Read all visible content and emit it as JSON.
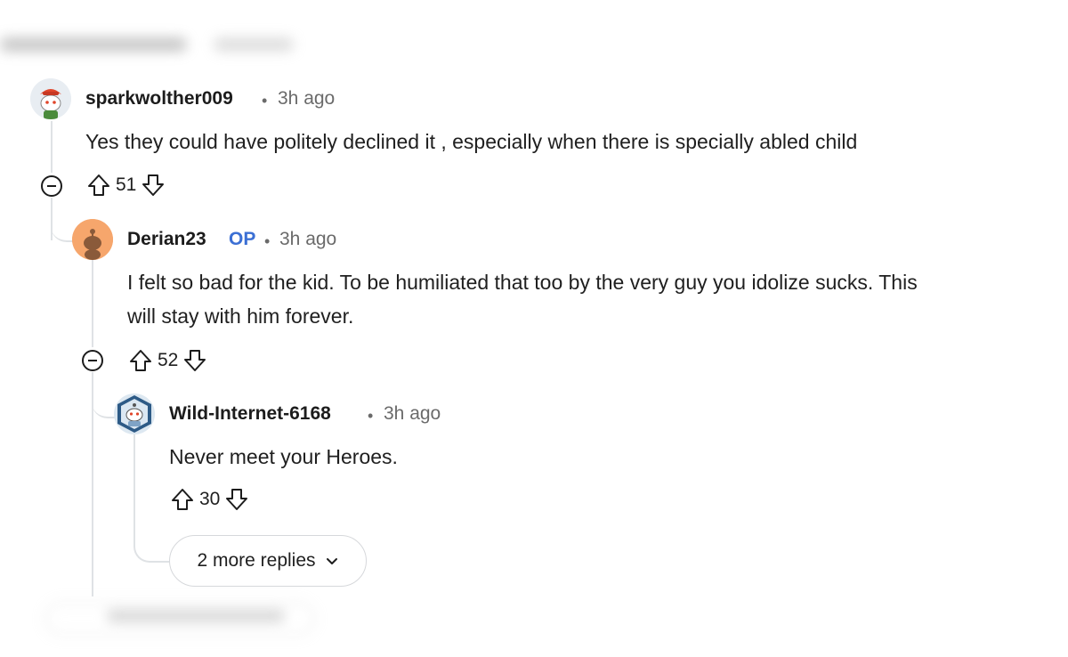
{
  "comments": [
    {
      "username": "sparkwolther009",
      "separator": "•",
      "time": "3h ago",
      "body_lines": [
        "Yes they could have politely declined it , especially when there is specially abled child"
      ],
      "votes": "51",
      "avatar": "snoo-avatar-red-hat",
      "icons": {
        "upvote": "upvote-arrow-icon",
        "downvote": "downvote-arrow-icon",
        "collapse": "collapse-minus-icon"
      }
    },
    {
      "username": "Derian23",
      "op_badge": "OP",
      "separator": "•",
      "time": "3h ago",
      "body_lines": [
        "I felt so bad for the kid. To be humiliated that too by the very guy you idolize sucks. This",
        "will stay with him forever."
      ],
      "votes": "52",
      "avatar": "default-snoo-orange",
      "icons": {
        "upvote": "upvote-arrow-icon",
        "downvote": "downvote-arrow-icon",
        "collapse": "collapse-minus-icon"
      }
    },
    {
      "username": "Wild-Internet-6168",
      "separator": "•",
      "time": "3h ago",
      "body_lines": [
        "Never meet your Heroes."
      ],
      "votes": "30",
      "avatar": "snoo-avatar-blue-hex",
      "icons": {
        "upvote": "upvote-arrow-icon",
        "downvote": "downvote-arrow-icon"
      }
    }
  ],
  "more_replies": {
    "label": "2 more replies",
    "icon": "chevron-down-icon"
  },
  "colors": {
    "op": "#3b6fd4",
    "thread_line": "#dfe2e5",
    "meta": "#6a6a6a"
  }
}
